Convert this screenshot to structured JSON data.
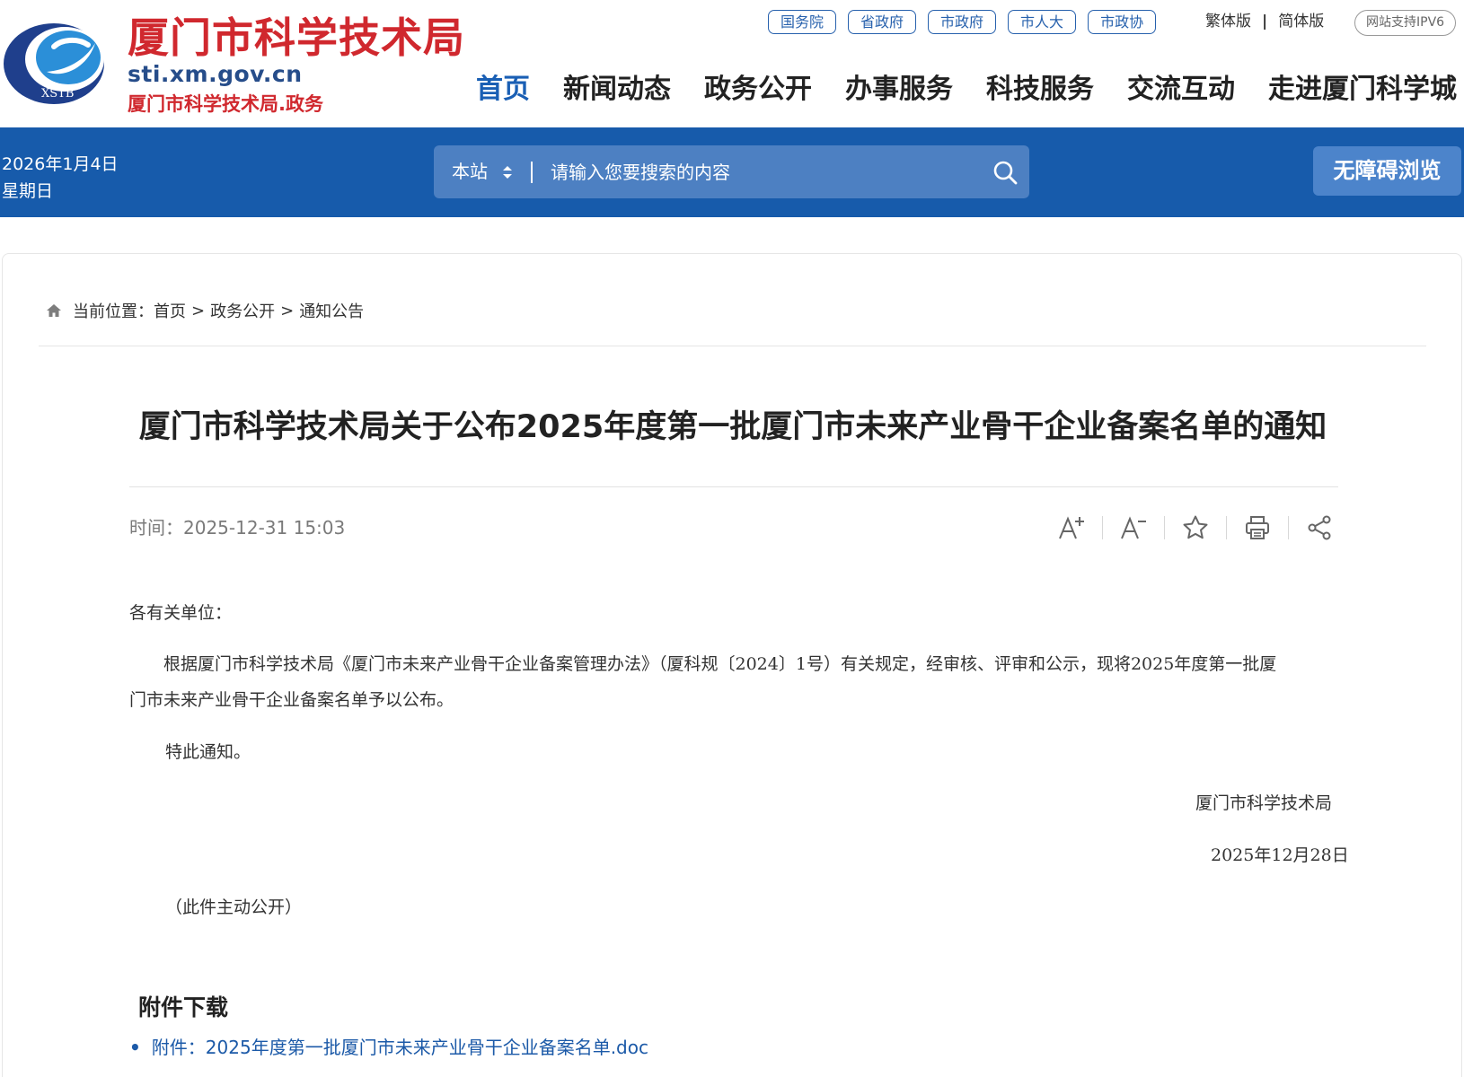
{
  "header": {
    "site_title": "厦门市科学技术局",
    "site_domain": "sti.xm.gov.cn",
    "site_subtitle": "厦门市科学技术局.政务",
    "logo_text": "XSTB",
    "gov_links": [
      "国务院",
      "省政府",
      "市政府",
      "市人大",
      "市政协"
    ],
    "lang_traditional": "繁体版",
    "lang_separator": "|",
    "lang_simplified": "简体版",
    "ipv6_badge": "网站支持IPV6",
    "nav": [
      "首页",
      "新闻动态",
      "政务公开",
      "办事服务",
      "科技服务",
      "交流互动",
      "走进厦门科学城"
    ],
    "nav_active_index": 0
  },
  "bluebar": {
    "date": "2026年1月4日",
    "weekday": "星期日",
    "search_scope": "本站",
    "search_placeholder": "请输入您要搜索的内容",
    "accessibility_button": "无障碍浏览"
  },
  "breadcrumb": {
    "label": "当前位置：",
    "items": [
      "首页",
      "政务公开",
      "通知公告"
    ],
    "separator": ">"
  },
  "article": {
    "title": "厦门市科学技术局关于公布2025年度第一批厦门市未来产业骨干企业备案名单的通知",
    "time_label": "时间：",
    "time_value": "2025-12-31 15:03",
    "tools": {
      "font_increase": "A+",
      "font_decrease": "A−"
    },
    "salutation": "各有关单位：",
    "paragraph_line1": "根据厦门市科学技术局《厦门市未来产业骨干企业备案管理办法》（厦科规〔2024〕1号）有关规定，经审核、评审和公示，现将2025年度第一批厦",
    "paragraph_line2": "门市未来产业骨干企业备案名单予以公布。",
    "closing": "特此通知。",
    "signature": "厦门市科学技术局",
    "signature_date": "2025年12月28日",
    "disclosure": "（此件主动公开）"
  },
  "attachments": {
    "heading": "附件下载",
    "items": [
      "附件：2025年度第一批厦门市未来产业骨干企业备案名单.doc"
    ]
  },
  "colors": {
    "brand_blue": "#175bab",
    "brand_red": "#d0282e",
    "link_blue": "#1c5aa8"
  }
}
